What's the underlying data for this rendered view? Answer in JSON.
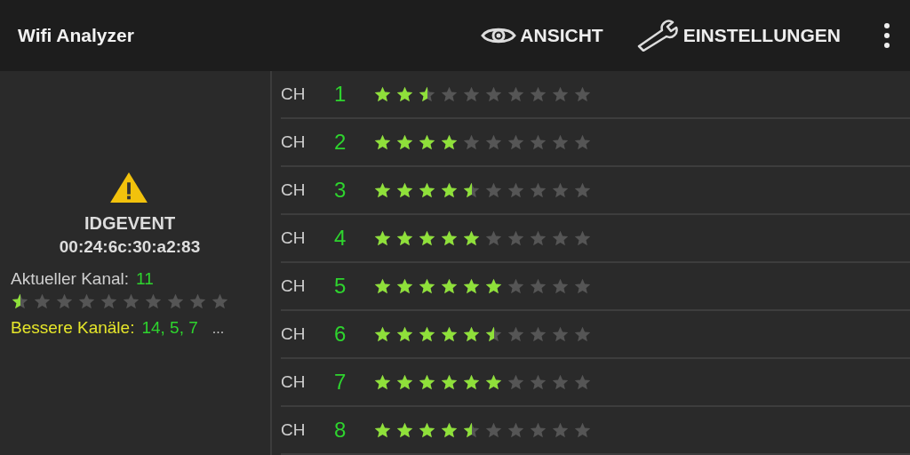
{
  "app_bar": {
    "title": "Wifi Analyzer",
    "actions": [
      {
        "kind": "view",
        "label": "ANSICHT"
      },
      {
        "kind": "settings",
        "label": "EINSTELLUNGEN"
      }
    ]
  },
  "network": {
    "ssid": "IDGEVENT",
    "bssid": "00:24:6c:30:a2:83",
    "current_channel_label": "Aktueller Kanal:",
    "current_channel": "11",
    "stars": 0.5,
    "better_channels_label": "Bessere Kanäle:",
    "better_channels": "14, 5, 7",
    "more": "..."
  },
  "channels": [
    {
      "prefix": "CH",
      "number": "1",
      "stars": 2.5
    },
    {
      "prefix": "CH",
      "number": "2",
      "stars": 4
    },
    {
      "prefix": "CH",
      "number": "3",
      "stars": 4.5
    },
    {
      "prefix": "CH",
      "number": "4",
      "stars": 5
    },
    {
      "prefix": "CH",
      "number": "5",
      "stars": 6
    },
    {
      "prefix": "CH",
      "number": "6",
      "stars": 5.5
    },
    {
      "prefix": "CH",
      "number": "7",
      "stars": 6
    },
    {
      "prefix": "CH",
      "number": "8",
      "stars": 4.5
    }
  ]
}
